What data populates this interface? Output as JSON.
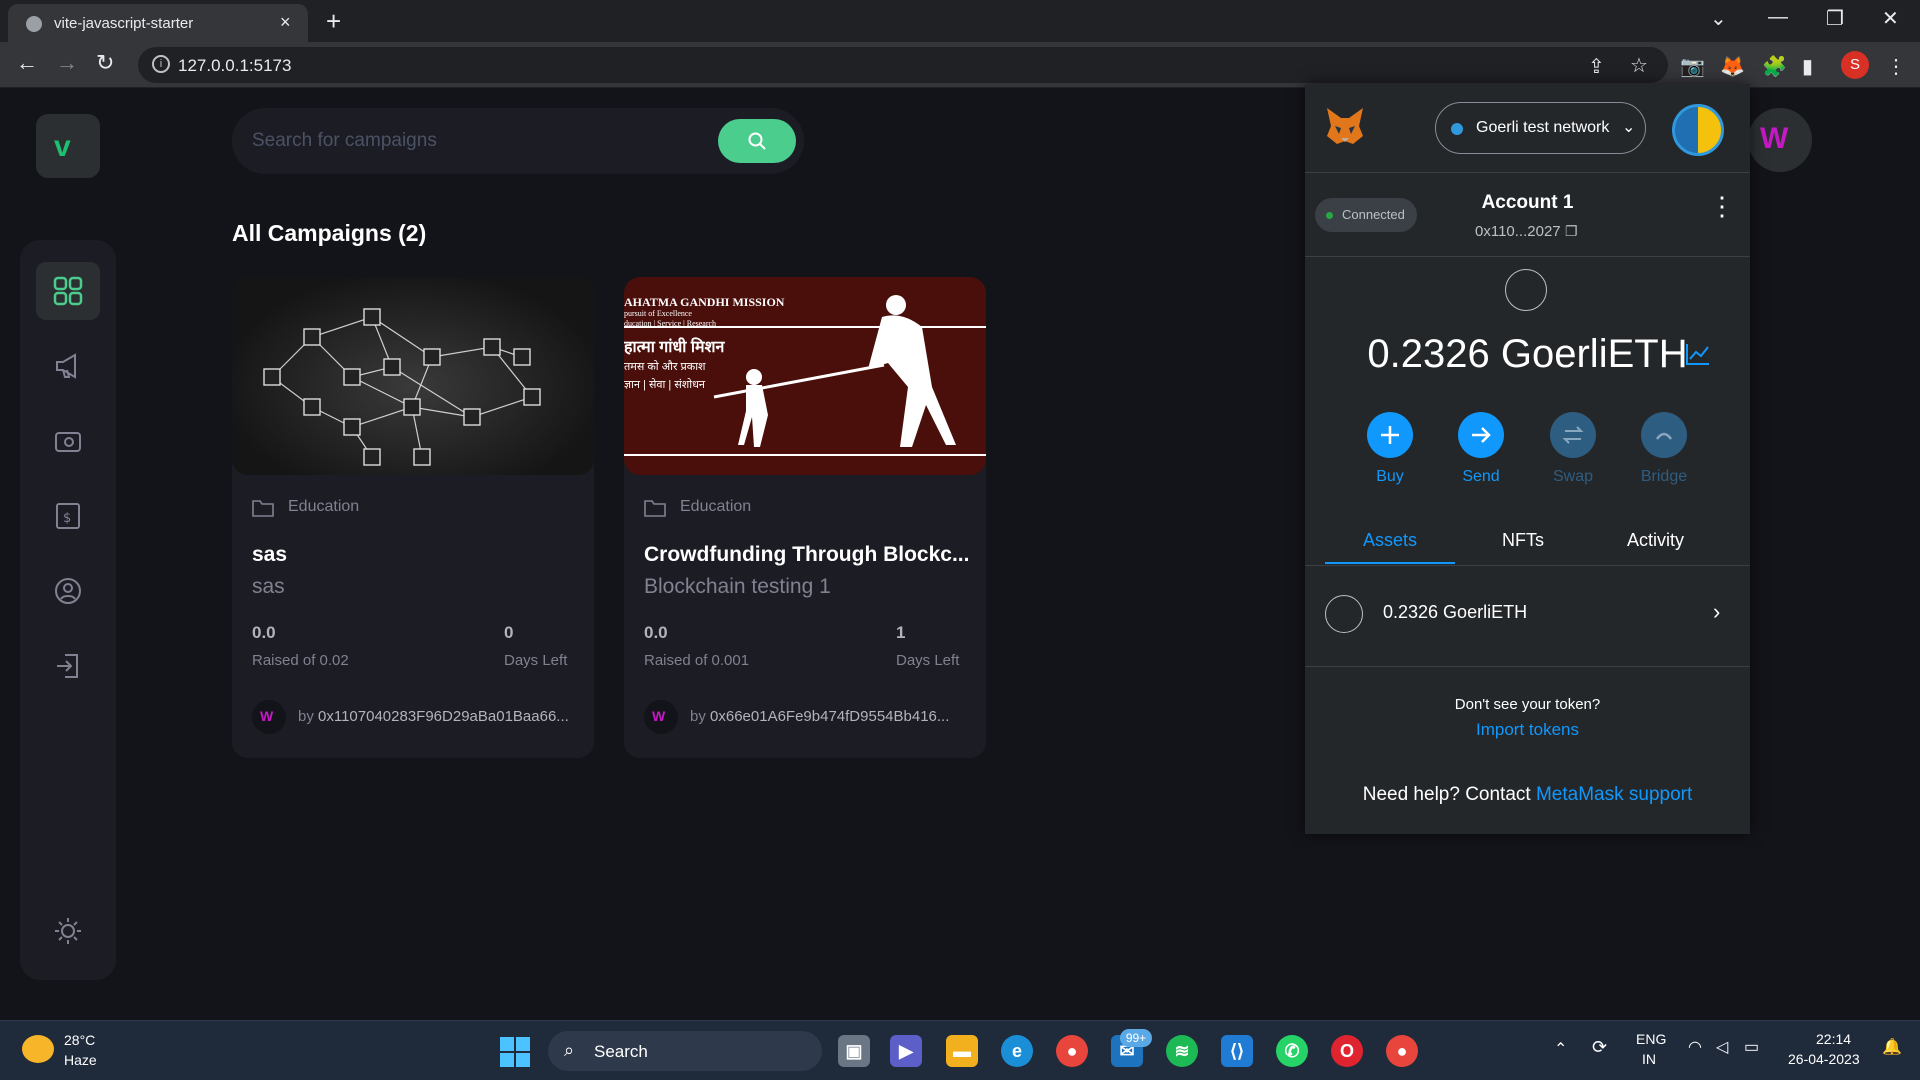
{
  "browser": {
    "tab_title": "vite-javascript-starter",
    "tab_close": "×",
    "new_tab": "+",
    "url": "127.0.0.1:5173",
    "profile_initial": "S"
  },
  "app": {
    "logo_letter": "v",
    "search": {
      "placeholder": "Search for campaigns"
    },
    "section_title": "All Campaigns (2)",
    "campaigns": [
      {
        "category": "Education",
        "title": "sas",
        "description": "sas",
        "amount_collected": "0.0",
        "raised_label": "Raised of 0.02",
        "days_left": "0",
        "days_label": "Days Left",
        "owner_prefix": "by ",
        "owner": "0x1107040283F96D29aBa01Baa66..."
      },
      {
        "category": "Education",
        "title": "Crowdfunding Through Blockc...",
        "description": "Blockchain testing 1",
        "amount_collected": "0.0",
        "raised_label": "Raised of 0.001",
        "days_left": "1",
        "days_label": "Days Left",
        "owner_prefix": "by ",
        "owner": "0x66e01A6Fe9b474fD9554Bb416...",
        "image_lines": [
          "AHATMA GANDHI MISSION",
          "pursuit of Excellence",
          "ducation | Service | Research",
          "हात्मा गांधी मिशन",
          "तमस को और प्रकाश",
          "ज्ञान | सेवा | संशोधन"
        ]
      }
    ]
  },
  "metamask": {
    "network": "Goerli test network",
    "connection_status": "Connected",
    "account_name": "Account 1",
    "address": "0x110...2027",
    "balance": "0.2326 GoerliETH",
    "actions": [
      "Buy",
      "Send",
      "Swap",
      "Bridge"
    ],
    "tabs": [
      "Assets",
      "NFTs",
      "Activity"
    ],
    "asset_row": "0.2326 GoerliETH",
    "dont_see": "Don't see your token?",
    "import_tokens": "Import tokens",
    "help_prefix": "Need help? Contact ",
    "help_link": "MetaMask support"
  },
  "taskbar": {
    "temperature": "28°C",
    "condition": "Haze",
    "search_label": "Search",
    "mail_badge": "99+",
    "language": "ENG",
    "region": "IN",
    "time": "22:14",
    "date": "26-04-2023"
  },
  "colors": {
    "accent_green": "#4acd8d",
    "metamask_blue": "#1098fc",
    "background": "#13131a",
    "card": "#1c1c24"
  }
}
